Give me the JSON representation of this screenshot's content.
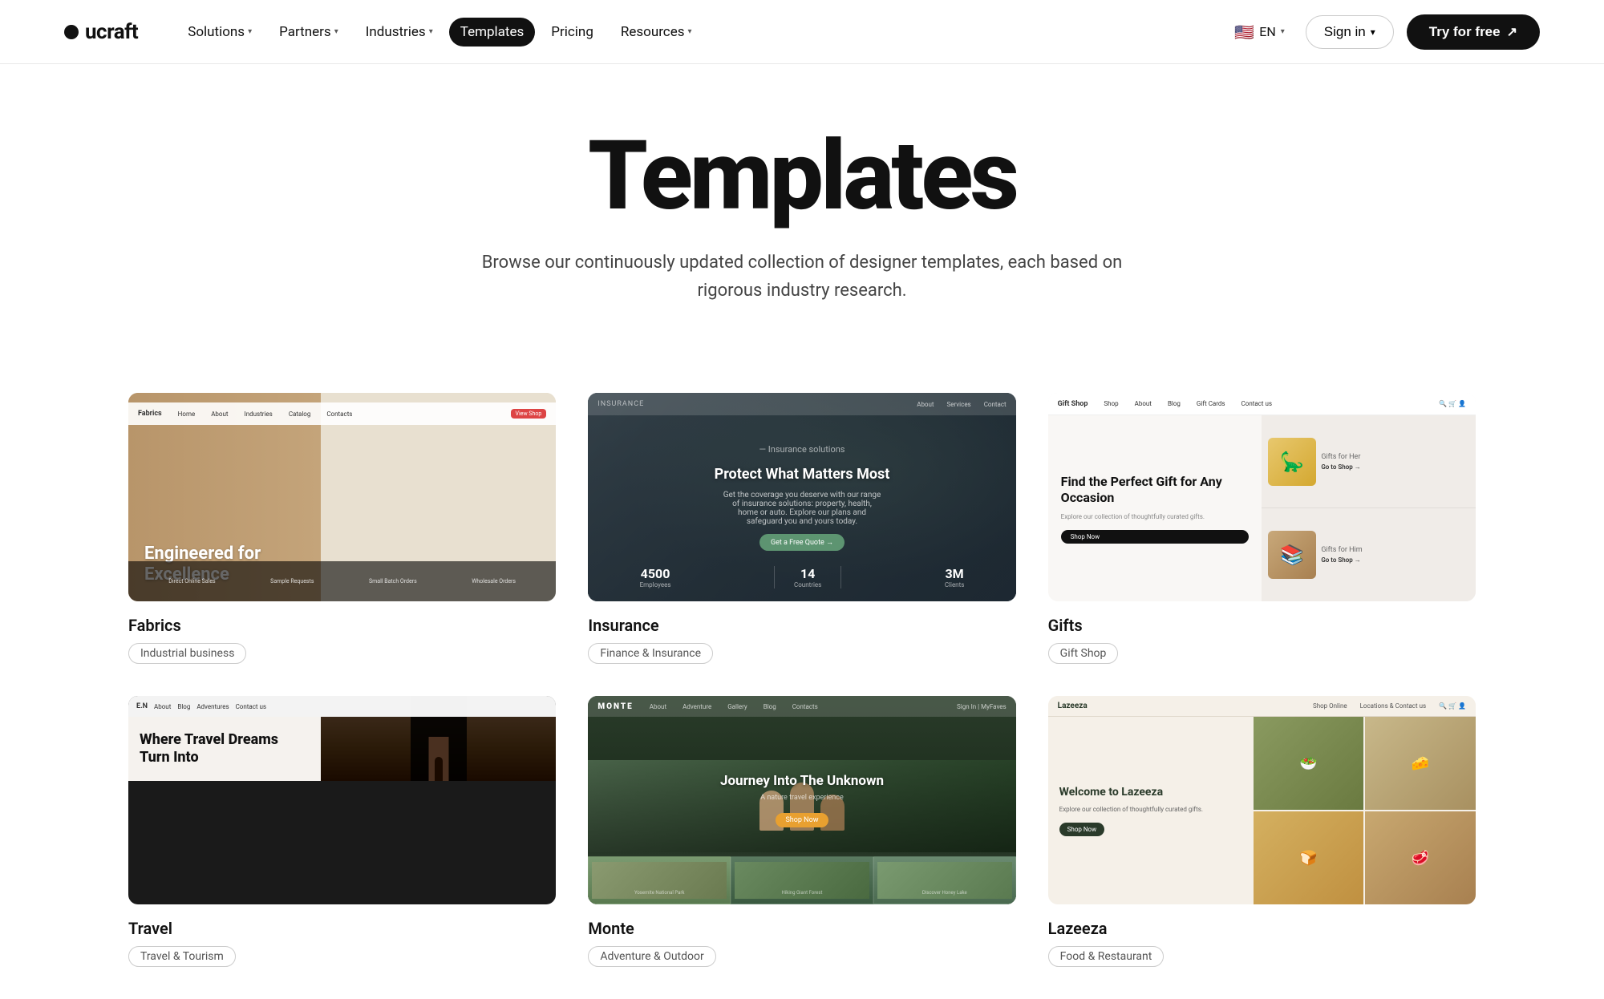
{
  "brand": {
    "name": "ucraft",
    "logo_dot": "●"
  },
  "nav": {
    "links": [
      {
        "id": "solutions",
        "label": "Solutions",
        "has_dropdown": true
      },
      {
        "id": "partners",
        "label": "Partners",
        "has_dropdown": true
      },
      {
        "id": "industries",
        "label": "Industries",
        "has_dropdown": true
      },
      {
        "id": "templates",
        "label": "Templates",
        "has_dropdown": false,
        "active": true
      },
      {
        "id": "pricing",
        "label": "Pricing",
        "has_dropdown": false
      },
      {
        "id": "resources",
        "label": "Resources",
        "has_dropdown": true
      }
    ],
    "sign_in_label": "Sign in",
    "try_free_label": "Try for free",
    "lang": "EN",
    "lang_flag": "🇺🇸"
  },
  "hero": {
    "title": "Templates",
    "subtitle": "Browse our continuously updated collection of designer templates, each based on rigorous industry research."
  },
  "templates": [
    {
      "id": "fabrics",
      "name": "Fabrics",
      "tag": "Industrial business",
      "thumb_type": "fabrics",
      "thumb_text": "Engineered for Excellence",
      "thumb_nav_logo": "Fabrics",
      "thumb_nav_items": [
        "About",
        "Industries",
        "Catalog",
        "Contacts",
        "View Shop"
      ],
      "thumb_bottom": [
        {
          "label": "Direct Online Sales"
        },
        {
          "label": "Sample Requests"
        },
        {
          "label": "Small Batch Orders"
        },
        {
          "label": "Wholesale Orders"
        }
      ]
    },
    {
      "id": "insurance",
      "name": "Insurance",
      "tag": "Finance & Insurance",
      "thumb_type": "insurance",
      "thumb_nav_items": [
        "Insurance Solutions"
      ],
      "thumb_title": "Protect What Matters Most",
      "thumb_sub": "Get the coverage you deserve with our range of insurance solutions: property, health, home or auto. Explore our plans and safeguard you and yours today.",
      "thumb_btn": "Get a Free Quote →",
      "stats": [
        {
          "number": "4500",
          "label": "Employees"
        },
        {
          "number": "14",
          "label": "Countries"
        },
        {
          "number": "3M",
          "label": "Clients"
        }
      ]
    },
    {
      "id": "gifts",
      "name": "Gifts",
      "tag": "Gift Shop",
      "thumb_type": "gifts",
      "thumb_headline": "Find the Perfect Gift for Any Occasion",
      "thumb_items": [
        {
          "label": "Gifts for Her",
          "link": "Go to Shop →",
          "emoji": "🦕"
        },
        {
          "label": "Gifts for Him",
          "link": "Go to Shop →",
          "emoji": "📚"
        }
      ]
    },
    {
      "id": "travel",
      "name": "Travel",
      "tag": "Travel & Tourism",
      "thumb_type": "travel",
      "thumb_logo": "E.N",
      "thumb_title": "Where Travel Dreams Turn Into"
    },
    {
      "id": "monte",
      "name": "Monte",
      "tag": "Adventure & Outdoor",
      "thumb_type": "monte",
      "thumb_logo": "MONTE",
      "thumb_nav_items": [
        "About",
        "Adventure",
        "Gallery",
        "Blog",
        "Contacts"
      ],
      "thumb_title": "Journey Into The Unknown",
      "thumb_sub": "A nature travel experience",
      "thumb_btn": "Shop Now",
      "thumb_places": [
        {
          "label": "Yosemite National Park"
        },
        {
          "label": "Hiking Giant Forest"
        },
        {
          "label": "Discover Honey Lake"
        }
      ]
    },
    {
      "id": "lazeeza",
      "name": "Lazeeza",
      "tag": "Food & Restaurant",
      "thumb_type": "lazeeza",
      "thumb_logo": "Lazeeza",
      "thumb_nav_items": [
        "Shop Online",
        "Locations & Contact us"
      ],
      "thumb_title": "Welcome to Lazeeza",
      "thumb_sub": "Explore our collection of thoughtfully curated gifts.",
      "thumb_btn": "Shop Now"
    }
  ],
  "colors": {
    "accent": "#111111",
    "brand": "#111111",
    "nav_active_bg": "#111111",
    "tag_border": "#cccccc",
    "tag_text": "#555555"
  }
}
